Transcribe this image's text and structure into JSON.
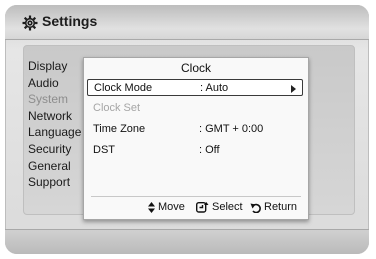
{
  "header": {
    "title": "Settings",
    "icon": "gear-icon"
  },
  "side_menu": {
    "items": [
      {
        "label": "Display",
        "dim": false
      },
      {
        "label": "Audio",
        "dim": false
      },
      {
        "label": "System",
        "dim": true
      },
      {
        "label": "Network",
        "dim": false
      },
      {
        "label": "Language",
        "dim": false
      },
      {
        "label": "Security",
        "dim": false
      },
      {
        "label": "General",
        "dim": false
      },
      {
        "label": "Support",
        "dim": false
      }
    ]
  },
  "dialog": {
    "title": "Clock",
    "rows": [
      {
        "label": "Clock Mode",
        "value": ": Auto",
        "selected": true,
        "disabled": false
      },
      {
        "label": "Clock Set",
        "value": "",
        "selected": false,
        "disabled": true
      },
      {
        "label": "Time Zone",
        "value": ": GMT + 0:00",
        "selected": false,
        "disabled": false
      },
      {
        "label": "DST",
        "value": ": Off",
        "selected": false,
        "disabled": false
      }
    ],
    "hints": {
      "move": "Move",
      "select": "Select",
      "return": "Return"
    }
  }
}
